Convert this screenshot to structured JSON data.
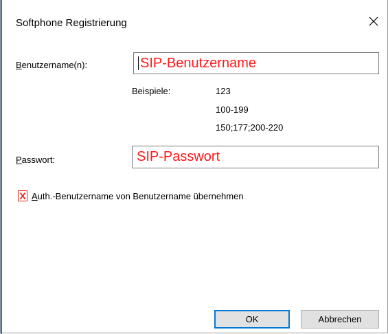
{
  "window": {
    "title": "Softphone Registrierung",
    "close_symbol": "×"
  },
  "username": {
    "label_mnemonic": "B",
    "label_rest": "enutzername(n):",
    "value": "SIP-Benutzername"
  },
  "examples": {
    "label": "Beispiele:",
    "items": [
      "123",
      "100-199",
      "150;177;200-220"
    ]
  },
  "password": {
    "label_mnemonic": "P",
    "label_rest": "asswort:",
    "value": "SIP-Passwort"
  },
  "auth_checkbox": {
    "mark": "X",
    "label_mnemonic": "A",
    "label_rest": "uth.-Benutzername von Benutzername übernehmen",
    "checked": true
  },
  "buttons": {
    "ok": "OK",
    "cancel": "Abbrechen"
  },
  "colors": {
    "annotation_red": "#ff1a1a",
    "focus_blue": "#0078d7",
    "window_edge": "#2b74c9"
  },
  "icons": {
    "close": "close-icon"
  }
}
